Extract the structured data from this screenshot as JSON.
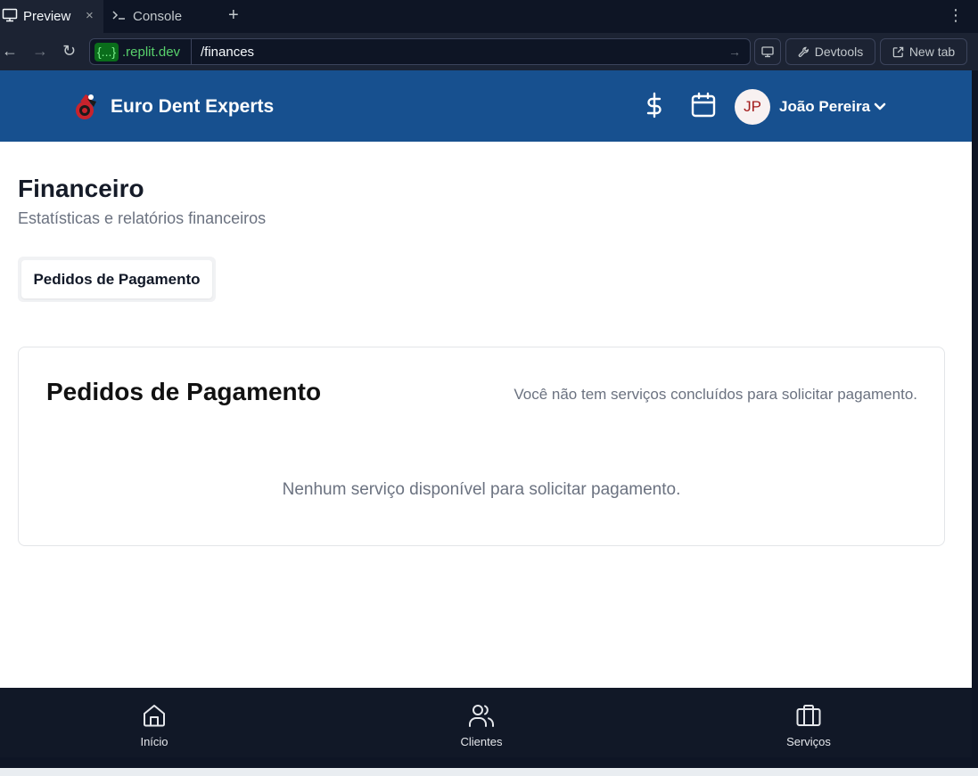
{
  "browser": {
    "tabs": [
      {
        "label": "Preview",
        "close": "×"
      },
      {
        "label": "Console"
      }
    ],
    "new_tab_symbol": "+",
    "more_symbol": "⋮",
    "back_symbol": "←",
    "forward_symbol": "→",
    "reload_symbol": "↻",
    "host_badge": "{...}",
    "host_rest": ".replit.dev",
    "path": "/finances",
    "go_symbol": "→",
    "devtools_label": "Devtools",
    "new_tab_label": "New tab"
  },
  "header": {
    "brand": "Euro Dent Experts",
    "user": {
      "initials": "JP",
      "name": "João Pereira"
    }
  },
  "page": {
    "title": "Financeiro",
    "subtitle": "Estatísticas e relatórios financeiros",
    "tabs": [
      {
        "label": "Pedidos de Pagamento"
      }
    ]
  },
  "card": {
    "title": "Pedidos de Pagamento",
    "description": "Você não tem serviços concluídos para solicitar pagamento.",
    "empty_message": "Nenhum serviço disponível para solicitar pagamento."
  },
  "bottom_nav": [
    {
      "label": "Início",
      "icon": "home-icon"
    },
    {
      "label": "Clientes",
      "icon": "users-icon"
    },
    {
      "label": "Serviços",
      "icon": "briefcase-icon"
    }
  ],
  "colors": {
    "header_bg": "#17508f",
    "bottom_nav_bg": "#111827",
    "replit_dark": "#0e1525",
    "replit_host_green": "#58d16c",
    "avatar_text": "#a31c1c"
  }
}
